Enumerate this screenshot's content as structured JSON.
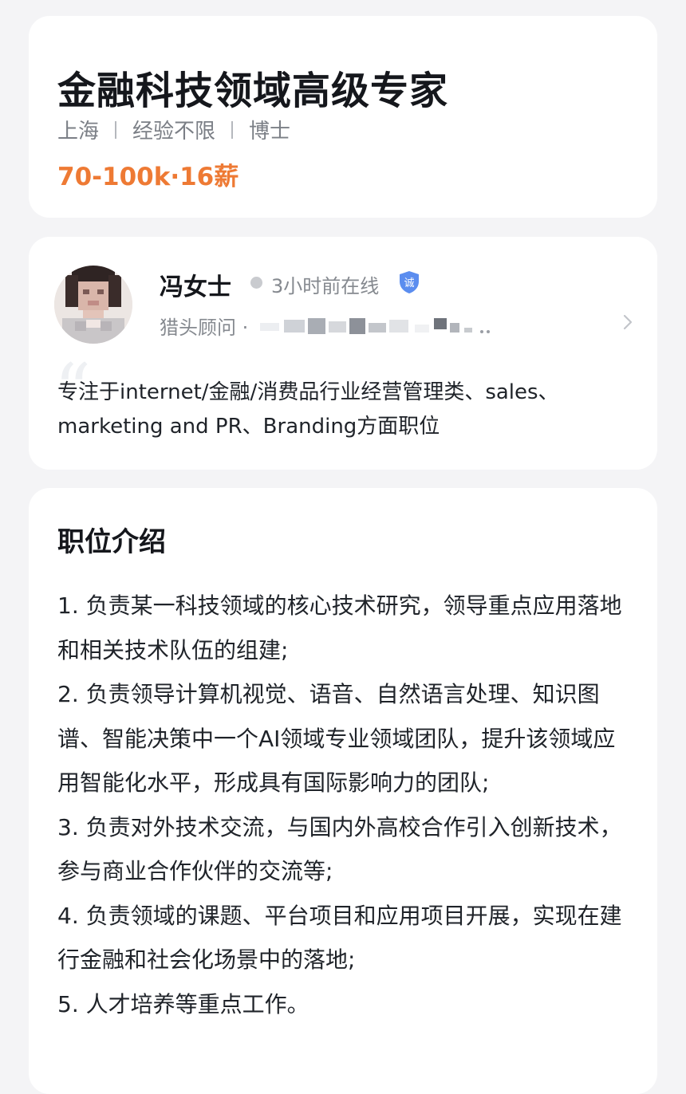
{
  "job": {
    "title": "金融科技领域高级专家",
    "city": "上海",
    "experience": "经验不限",
    "education": "博士",
    "salary": "70-100k·16薪",
    "salary_color": "#ee7a34"
  },
  "recruiter": {
    "name": "冯女士",
    "online_status": "3小时前在线",
    "verified_badge_text": "诚",
    "role": "猎头顾问 ·",
    "bio": "专注于internet/金融/消费品行业经营管理类、sales、marketing and PR、Branding方面职位",
    "icons": [
      "avatar",
      "online-dot-icon",
      "verified-shield-icon",
      "chevron-right-icon"
    ]
  },
  "description": {
    "heading": "职位介绍",
    "items": [
      "1. 负责某一科技领域的核心技术研究，领导重点应用落地和相关技术队伍的组建;",
      "2. 负责领导计算机视觉、语音、自然语言处理、知识图谱、智能决策中一个AI领域专业领域团队，提升该领域应用智能化水平，形成具有国际影响力的团队;",
      "3. 负责对外技术交流，与国内外高校合作引入创新技术，参与商业合作伙伴的交流等;",
      "4. 负责领域的课题、平台项目和应用项目开展，实现在建行金融和社会化场景中的落地;",
      "5. 人才培养等重点工作。"
    ]
  }
}
